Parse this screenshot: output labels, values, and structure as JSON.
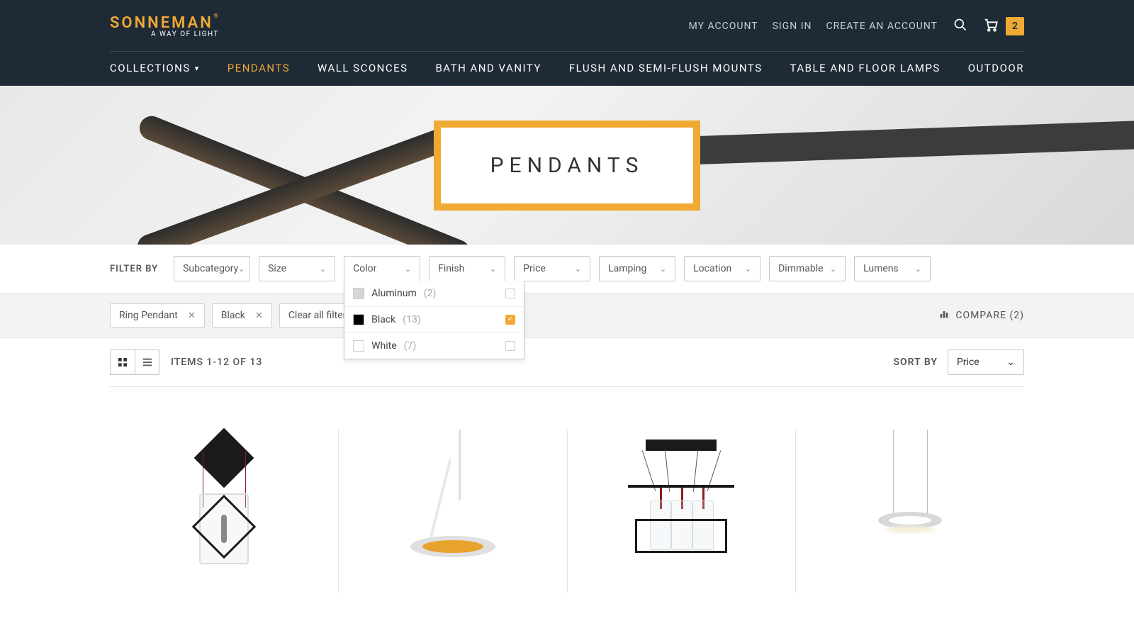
{
  "brand": {
    "name": "SONNEMAN",
    "tagline": "A WAY OF LIGHT"
  },
  "header": {
    "my_account": "MY ACCOUNT",
    "sign_in": "SIGN IN",
    "create_account": "CREATE AN ACCOUNT",
    "cart_count": "2"
  },
  "nav": {
    "collections": "COLLECTIONS",
    "pendants": "PENDANTS",
    "wall_sconces": "WALL SCONCES",
    "bath_vanity": "BATH AND VANITY",
    "flush": "FLUSH AND SEMI-FLUSH MOUNTS",
    "table_floor": "TABLE AND FLOOR LAMPS",
    "outdoor": "OUTDOOR"
  },
  "hero": {
    "title": "PENDANTS"
  },
  "filters": {
    "label": "FILTER BY",
    "subcategory": "Subcategory",
    "size": "Size",
    "color": "Color",
    "finish": "Finish",
    "price": "Price",
    "lamping": "Lamping",
    "location": "Location",
    "dimmable": "Dimmable",
    "lumens": "Lumens"
  },
  "color_options": [
    {
      "label": "Aluminum",
      "count": "(2)",
      "checked": false
    },
    {
      "label": "Black",
      "count": "(13)",
      "checked": true
    },
    {
      "label": "White",
      "count": "(7)",
      "checked": false
    }
  ],
  "active_chips": {
    "ring_pendant": "Ring Pendant",
    "black": "Black",
    "clear_all": "Clear all filters"
  },
  "compare": {
    "label": "COMPARE (2)"
  },
  "toolbar": {
    "items": "ITEMS 1-12 OF 13",
    "sort_label": "SORT BY",
    "sort_value": "Price"
  }
}
